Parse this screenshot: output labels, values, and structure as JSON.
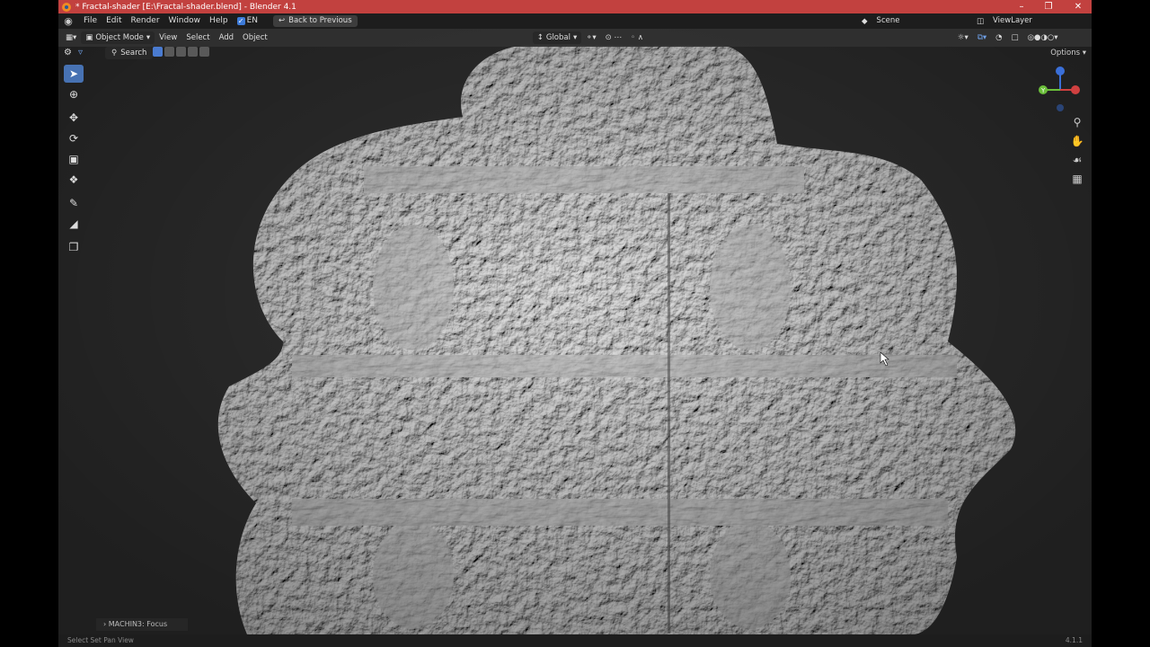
{
  "window": {
    "title": "* Fractal-shader [E:\\Fractal-shader.blend] - Blender 4.1"
  },
  "menu": {
    "items": [
      "File",
      "Edit",
      "Render",
      "Window",
      "Help"
    ],
    "language": "EN",
    "back_button": "Back to Previous"
  },
  "scene": {
    "name": "Scene"
  },
  "view_layer": {
    "name": "ViewLayer"
  },
  "viewport_header": {
    "mode": "Object Mode",
    "menus": [
      "View",
      "Select",
      "Add",
      "Object"
    ],
    "transform_orientation": "Global"
  },
  "tool_header": {
    "search": "Search",
    "options": "Options"
  },
  "gizmo": {
    "y_label": "Y",
    "z_label": "Z",
    "x_label": "X"
  },
  "last_operator": {
    "label": "MACHIN3: Focus"
  },
  "statusbar": {
    "text": "Select    Set    Pan View",
    "version": "4.1.1"
  },
  "colors": {
    "titlebar": "#c2413f",
    "accent": "#4772b3",
    "background": "#303030"
  },
  "icons": [
    "blender-logo-icon",
    "select-box-icon",
    "cursor-icon",
    "move-icon",
    "rotate-icon",
    "scale-icon",
    "transform-icon",
    "annotate-icon",
    "measure-icon",
    "add-cube-icon",
    "zoom-icon",
    "hand-icon",
    "camera-icon",
    "grid-icon"
  ]
}
